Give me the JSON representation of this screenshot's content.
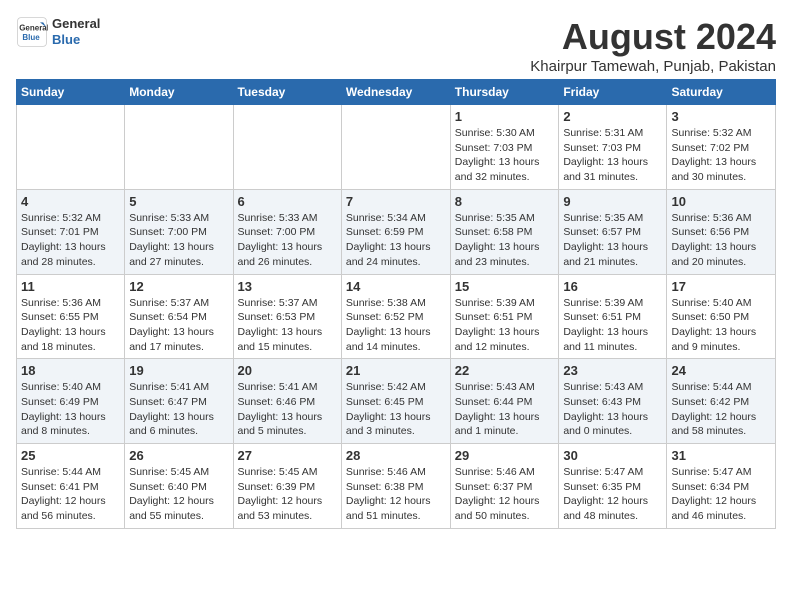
{
  "logo": {
    "line1": "General",
    "line2": "Blue"
  },
  "title": "August 2024",
  "subtitle": "Khairpur Tamewah, Punjab, Pakistan",
  "days_header": [
    "Sunday",
    "Monday",
    "Tuesday",
    "Wednesday",
    "Thursday",
    "Friday",
    "Saturday"
  ],
  "weeks": [
    [
      {
        "day": "",
        "info": ""
      },
      {
        "day": "",
        "info": ""
      },
      {
        "day": "",
        "info": ""
      },
      {
        "day": "",
        "info": ""
      },
      {
        "day": "1",
        "info": "Sunrise: 5:30 AM\nSunset: 7:03 PM\nDaylight: 13 hours\nand 32 minutes."
      },
      {
        "day": "2",
        "info": "Sunrise: 5:31 AM\nSunset: 7:03 PM\nDaylight: 13 hours\nand 31 minutes."
      },
      {
        "day": "3",
        "info": "Sunrise: 5:32 AM\nSunset: 7:02 PM\nDaylight: 13 hours\nand 30 minutes."
      }
    ],
    [
      {
        "day": "4",
        "info": "Sunrise: 5:32 AM\nSunset: 7:01 PM\nDaylight: 13 hours\nand 28 minutes."
      },
      {
        "day": "5",
        "info": "Sunrise: 5:33 AM\nSunset: 7:00 PM\nDaylight: 13 hours\nand 27 minutes."
      },
      {
        "day": "6",
        "info": "Sunrise: 5:33 AM\nSunset: 7:00 PM\nDaylight: 13 hours\nand 26 minutes."
      },
      {
        "day": "7",
        "info": "Sunrise: 5:34 AM\nSunset: 6:59 PM\nDaylight: 13 hours\nand 24 minutes."
      },
      {
        "day": "8",
        "info": "Sunrise: 5:35 AM\nSunset: 6:58 PM\nDaylight: 13 hours\nand 23 minutes."
      },
      {
        "day": "9",
        "info": "Sunrise: 5:35 AM\nSunset: 6:57 PM\nDaylight: 13 hours\nand 21 minutes."
      },
      {
        "day": "10",
        "info": "Sunrise: 5:36 AM\nSunset: 6:56 PM\nDaylight: 13 hours\nand 20 minutes."
      }
    ],
    [
      {
        "day": "11",
        "info": "Sunrise: 5:36 AM\nSunset: 6:55 PM\nDaylight: 13 hours\nand 18 minutes."
      },
      {
        "day": "12",
        "info": "Sunrise: 5:37 AM\nSunset: 6:54 PM\nDaylight: 13 hours\nand 17 minutes."
      },
      {
        "day": "13",
        "info": "Sunrise: 5:37 AM\nSunset: 6:53 PM\nDaylight: 13 hours\nand 15 minutes."
      },
      {
        "day": "14",
        "info": "Sunrise: 5:38 AM\nSunset: 6:52 PM\nDaylight: 13 hours\nand 14 minutes."
      },
      {
        "day": "15",
        "info": "Sunrise: 5:39 AM\nSunset: 6:51 PM\nDaylight: 13 hours\nand 12 minutes."
      },
      {
        "day": "16",
        "info": "Sunrise: 5:39 AM\nSunset: 6:51 PM\nDaylight: 13 hours\nand 11 minutes."
      },
      {
        "day": "17",
        "info": "Sunrise: 5:40 AM\nSunset: 6:50 PM\nDaylight: 13 hours\nand 9 minutes."
      }
    ],
    [
      {
        "day": "18",
        "info": "Sunrise: 5:40 AM\nSunset: 6:49 PM\nDaylight: 13 hours\nand 8 minutes."
      },
      {
        "day": "19",
        "info": "Sunrise: 5:41 AM\nSunset: 6:47 PM\nDaylight: 13 hours\nand 6 minutes."
      },
      {
        "day": "20",
        "info": "Sunrise: 5:41 AM\nSunset: 6:46 PM\nDaylight: 13 hours\nand 5 minutes."
      },
      {
        "day": "21",
        "info": "Sunrise: 5:42 AM\nSunset: 6:45 PM\nDaylight: 13 hours\nand 3 minutes."
      },
      {
        "day": "22",
        "info": "Sunrise: 5:43 AM\nSunset: 6:44 PM\nDaylight: 13 hours\nand 1 minute."
      },
      {
        "day": "23",
        "info": "Sunrise: 5:43 AM\nSunset: 6:43 PM\nDaylight: 13 hours\nand 0 minutes."
      },
      {
        "day": "24",
        "info": "Sunrise: 5:44 AM\nSunset: 6:42 PM\nDaylight: 12 hours\nand 58 minutes."
      }
    ],
    [
      {
        "day": "25",
        "info": "Sunrise: 5:44 AM\nSunset: 6:41 PM\nDaylight: 12 hours\nand 56 minutes."
      },
      {
        "day": "26",
        "info": "Sunrise: 5:45 AM\nSunset: 6:40 PM\nDaylight: 12 hours\nand 55 minutes."
      },
      {
        "day": "27",
        "info": "Sunrise: 5:45 AM\nSunset: 6:39 PM\nDaylight: 12 hours\nand 53 minutes."
      },
      {
        "day": "28",
        "info": "Sunrise: 5:46 AM\nSunset: 6:38 PM\nDaylight: 12 hours\nand 51 minutes."
      },
      {
        "day": "29",
        "info": "Sunrise: 5:46 AM\nSunset: 6:37 PM\nDaylight: 12 hours\nand 50 minutes."
      },
      {
        "day": "30",
        "info": "Sunrise: 5:47 AM\nSunset: 6:35 PM\nDaylight: 12 hours\nand 48 minutes."
      },
      {
        "day": "31",
        "info": "Sunrise: 5:47 AM\nSunset: 6:34 PM\nDaylight: 12 hours\nand 46 minutes."
      }
    ]
  ]
}
